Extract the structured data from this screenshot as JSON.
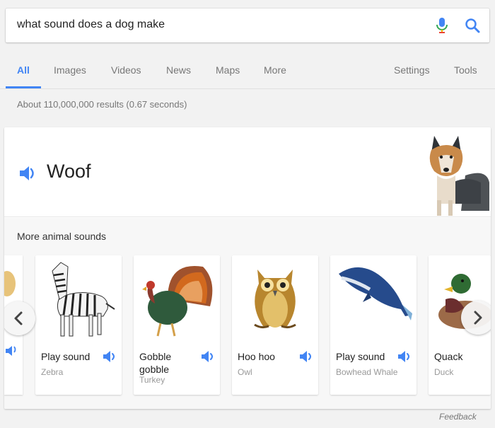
{
  "search": {
    "query": "what sound does a dog make"
  },
  "tabs": [
    {
      "label": "All",
      "active": true
    },
    {
      "label": "Images"
    },
    {
      "label": "Videos"
    },
    {
      "label": "News"
    },
    {
      "label": "Maps"
    },
    {
      "label": "More"
    }
  ],
  "tools": {
    "settings": "Settings",
    "tools": "Tools"
  },
  "result_stats": "About 110,000,000 results (0.67 seconds)",
  "answer": {
    "sound": "Woof"
  },
  "more_sounds": {
    "title": "More animal sounds",
    "animals": [
      {
        "sound": "Play sound",
        "name": "Zebra"
      },
      {
        "sound": "Gobble gobble",
        "name": "Turkey"
      },
      {
        "sound": "Hoo hoo",
        "name": "Owl"
      },
      {
        "sound": "Play sound",
        "name": "Bowhead Whale"
      },
      {
        "sound": "Quack",
        "name": "Duck"
      }
    ]
  },
  "feedback": "Feedback",
  "colors": {
    "accent": "#4285f4",
    "mic_red": "#ea4335"
  }
}
